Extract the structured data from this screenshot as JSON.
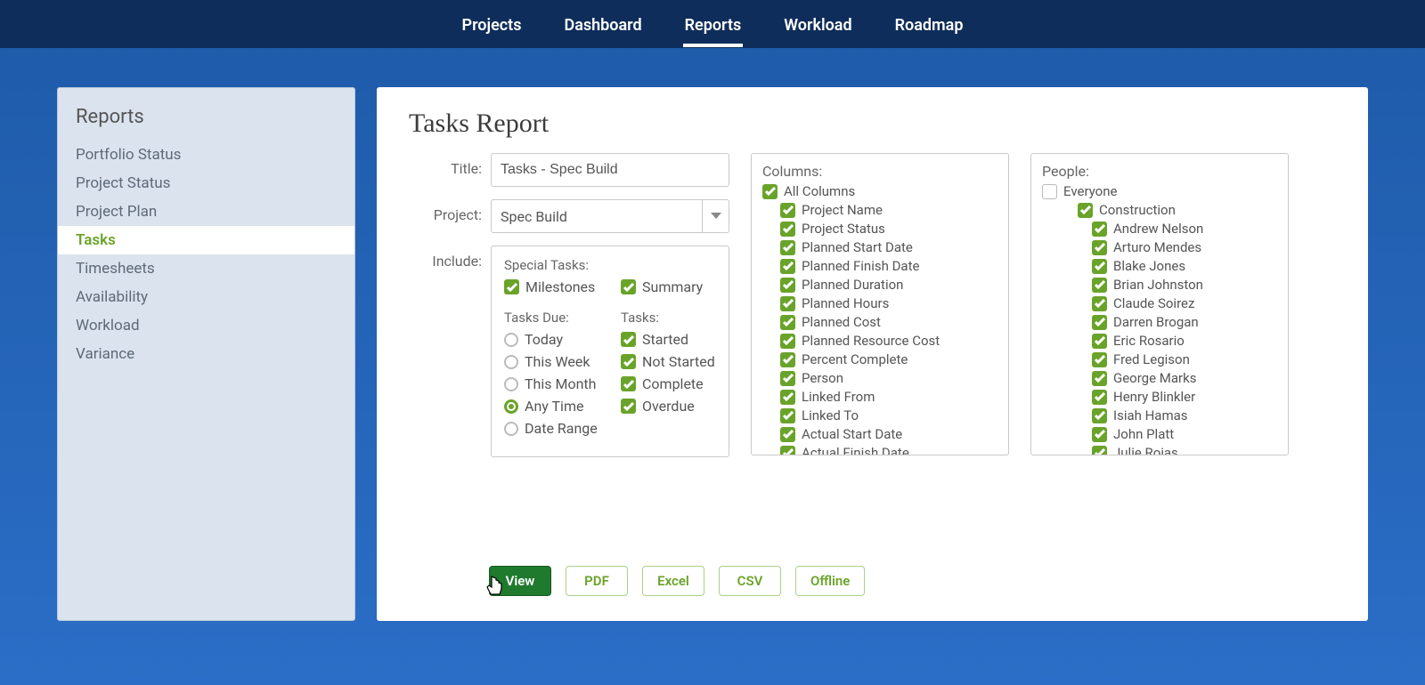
{
  "topnav": {
    "items": [
      "Projects",
      "Dashboard",
      "Reports",
      "Workload",
      "Roadmap"
    ],
    "active_index": 2
  },
  "sidebar": {
    "title": "Reports",
    "items": [
      "Portfolio Status",
      "Project Status",
      "Project Plan",
      "Tasks",
      "Timesheets",
      "Availability",
      "Workload",
      "Variance"
    ],
    "active_index": 3
  },
  "page": {
    "title": "Tasks Report",
    "title_label": "Title:",
    "title_value": "Tasks - Spec Build",
    "project_label": "Project:",
    "project_value": "Spec Build",
    "include_label": "Include:"
  },
  "include": {
    "special_tasks_label": "Special Tasks:",
    "special_tasks": [
      {
        "label": "Milestones",
        "checked": true
      },
      {
        "label": "Summary",
        "checked": true
      }
    ],
    "tasks_due_label": "Tasks Due:",
    "tasks_due": [
      {
        "label": "Today",
        "selected": false
      },
      {
        "label": "This Week",
        "selected": false
      },
      {
        "label": "This Month",
        "selected": false
      },
      {
        "label": "Any Time",
        "selected": true
      },
      {
        "label": "Date Range",
        "selected": false
      }
    ],
    "tasks_label": "Tasks:",
    "tasks": [
      {
        "label": "Started",
        "checked": true
      },
      {
        "label": "Not Started",
        "checked": true
      },
      {
        "label": "Complete",
        "checked": true
      },
      {
        "label": "Overdue",
        "checked": true
      }
    ]
  },
  "columns": {
    "label": "Columns:",
    "root": {
      "label": "All Columns",
      "checked": true
    },
    "items": [
      {
        "label": "Project Name",
        "checked": true
      },
      {
        "label": "Project Status",
        "checked": true
      },
      {
        "label": "Planned Start Date",
        "checked": true
      },
      {
        "label": "Planned Finish Date",
        "checked": true
      },
      {
        "label": "Planned Duration",
        "checked": true
      },
      {
        "label": "Planned Hours",
        "checked": true
      },
      {
        "label": "Planned Cost",
        "checked": true
      },
      {
        "label": "Planned Resource Cost",
        "checked": true
      },
      {
        "label": "Percent Complete",
        "checked": true
      },
      {
        "label": "Person",
        "checked": true
      },
      {
        "label": "Linked From",
        "checked": true
      },
      {
        "label": "Linked To",
        "checked": true
      },
      {
        "label": "Actual Start Date",
        "checked": true
      },
      {
        "label": "Actual Finish Date",
        "checked": true
      }
    ]
  },
  "people": {
    "label": "People:",
    "root": {
      "label": "Everyone",
      "checked": false
    },
    "groups": [
      {
        "label": "Construction",
        "checked": true,
        "members": [
          {
            "label": "Andrew Nelson",
            "checked": true
          },
          {
            "label": "Arturo Mendes",
            "checked": true
          },
          {
            "label": "Blake Jones",
            "checked": true
          },
          {
            "label": "Brian Johnston",
            "checked": true
          },
          {
            "label": "Claude Soirez",
            "checked": true
          },
          {
            "label": "Darren Brogan",
            "checked": true
          },
          {
            "label": "Eric Rosario",
            "checked": true
          },
          {
            "label": "Fred Legison",
            "checked": true
          },
          {
            "label": "George Marks",
            "checked": true
          },
          {
            "label": "Henry Blinkler",
            "checked": true
          },
          {
            "label": "Isiah Hamas",
            "checked": true
          },
          {
            "label": "John Platt",
            "checked": true
          },
          {
            "label": "Julie Rojas",
            "checked": true
          }
        ]
      }
    ]
  },
  "buttons": {
    "view": "View",
    "pdf": "PDF",
    "excel": "Excel",
    "csv": "CSV",
    "offline": "Offline"
  }
}
